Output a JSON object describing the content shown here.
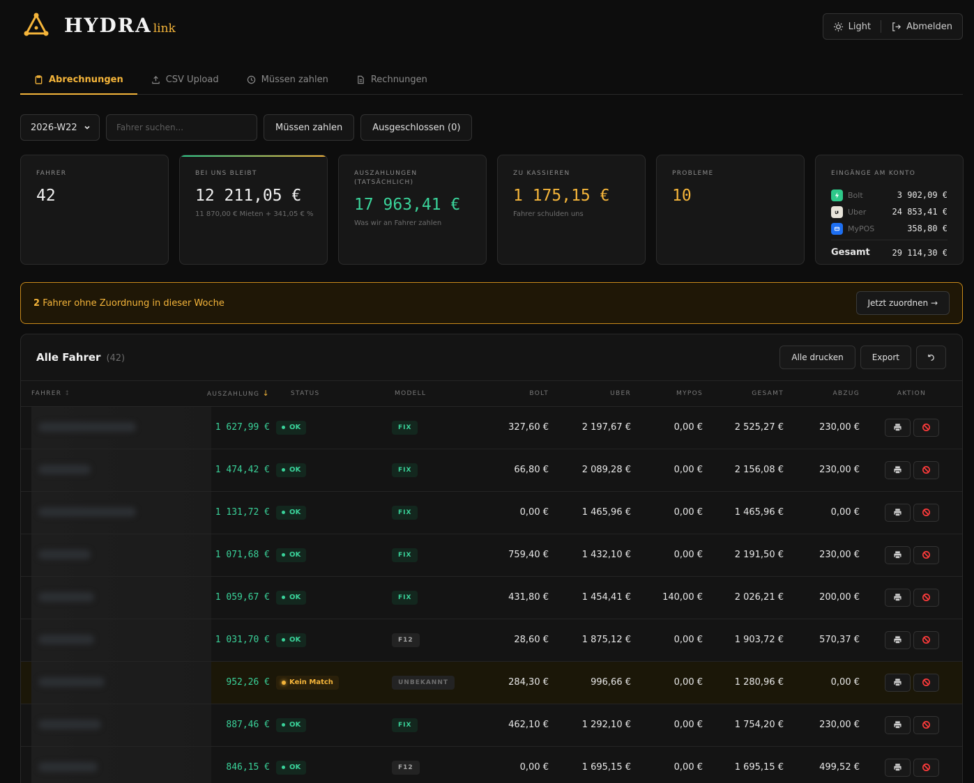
{
  "brand": {
    "main": "HYDRA",
    "sub": "link"
  },
  "header": {
    "theme_label": "Light",
    "logout_label": "Abmelden"
  },
  "tabs": [
    {
      "label": "Abrechnungen",
      "icon": "clipboard-icon",
      "active": true
    },
    {
      "label": "CSV Upload",
      "icon": "upload-icon",
      "active": false
    },
    {
      "label": "Müssen zahlen",
      "icon": "clock-icon",
      "active": false
    },
    {
      "label": "Rechnungen",
      "icon": "document-icon",
      "active": false
    }
  ],
  "toolbar": {
    "week": "2026-W22",
    "search_placeholder": "Fahrer suchen...",
    "must_pay_label": "Müssen zahlen",
    "excluded_label": "Ausgeschlossen (0)"
  },
  "cards": {
    "drivers": {
      "label": "Fahrer",
      "value": "42"
    },
    "stays": {
      "label": "Bei uns bleibt",
      "value": "12 211,05 €",
      "sub": "11 870,00 € Mieten + 341,05 € %"
    },
    "payouts": {
      "label": "Auszahlungen (tatsächlich)",
      "value": "17 963,41 €",
      "sub": "Was wir an Fahrer zahlen"
    },
    "collect": {
      "label": "Zu kassieren",
      "value": "1 175,15 €",
      "sub": "Fahrer schulden uns"
    },
    "problems": {
      "label": "Probleme",
      "value": "10"
    },
    "accounts": {
      "label": "Eingänge am Konto",
      "items": [
        {
          "name": "Bolt",
          "value": "3 902,09 €",
          "color": "#2ec98a"
        },
        {
          "name": "Uber",
          "value": "24 853,41 €",
          "color": "#e8e4da"
        },
        {
          "name": "MyPOS",
          "value": "358,80 €",
          "color": "#1d6ff2"
        }
      ],
      "total_label": "Gesamt",
      "total_value": "29 114,30 €"
    }
  },
  "warning": {
    "count": "2",
    "text": "Fahrer ohne Zuordnung in dieser Woche",
    "button": "Jetzt zuordnen →"
  },
  "table": {
    "title": "Alle Fahrer",
    "count": "(42)",
    "print_all": "Alle drucken",
    "export": "Export",
    "columns": {
      "driver": "Fahrer",
      "payout": "Auszahlung",
      "status": "Status",
      "model": "Modell",
      "bolt": "Bolt",
      "uber": "Uber",
      "mypos": "MyPOS",
      "total": "Gesamt",
      "deduction": "Abzug",
      "action": "Aktion"
    },
    "rows": [
      {
        "payout": "1 627,99 €",
        "status": "OK",
        "model": "FIX",
        "bolt": "327,60 €",
        "uber": "2 197,67 €",
        "mypos": "0,00 €",
        "total": "2 525,27 €",
        "deduction": "230,00 €"
      },
      {
        "payout": "1 474,42 €",
        "status": "OK",
        "model": "FIX",
        "bolt": "66,80 €",
        "uber": "2 089,28 €",
        "mypos": "0,00 €",
        "total": "2 156,08 €",
        "deduction": "230,00 €"
      },
      {
        "payout": "1 131,72 €",
        "status": "OK",
        "model": "FIX",
        "bolt": "0,00 €",
        "uber": "1 465,96 €",
        "mypos": "0,00 €",
        "total": "1 465,96 €",
        "deduction": "0,00 €"
      },
      {
        "payout": "1 071,68 €",
        "status": "OK",
        "model": "FIX",
        "bolt": "759,40 €",
        "uber": "1 432,10 €",
        "mypos": "0,00 €",
        "total": "2 191,50 €",
        "deduction": "230,00 €"
      },
      {
        "payout": "1 059,67 €",
        "status": "OK",
        "model": "FIX",
        "bolt": "431,80 €",
        "uber": "1 454,41 €",
        "mypos": "140,00 €",
        "total": "2 026,21 €",
        "deduction": "200,00 €"
      },
      {
        "payout": "1 031,70 €",
        "status": "OK",
        "model": "F12",
        "bolt": "28,60 €",
        "uber": "1 875,12 €",
        "mypos": "0,00 €",
        "total": "1 903,72 €",
        "deduction": "570,37 €"
      },
      {
        "payout": "952,26 €",
        "status": "Kein Match",
        "model": "UNBEKANNT",
        "bolt": "284,30 €",
        "uber": "996,66 €",
        "mypos": "0,00 €",
        "total": "1 280,96 €",
        "deduction": "0,00 €"
      },
      {
        "payout": "887,46 €",
        "status": "OK",
        "model": "FIX",
        "bolt": "462,10 €",
        "uber": "1 292,10 €",
        "mypos": "0,00 €",
        "total": "1 754,20 €",
        "deduction": "230,00 €"
      },
      {
        "payout": "846,15 €",
        "status": "OK",
        "model": "F12",
        "bolt": "0,00 €",
        "uber": "1 695,15 €",
        "mypos": "0,00 €",
        "total": "1 695,15 €",
        "deduction": "499,52 €"
      }
    ]
  }
}
